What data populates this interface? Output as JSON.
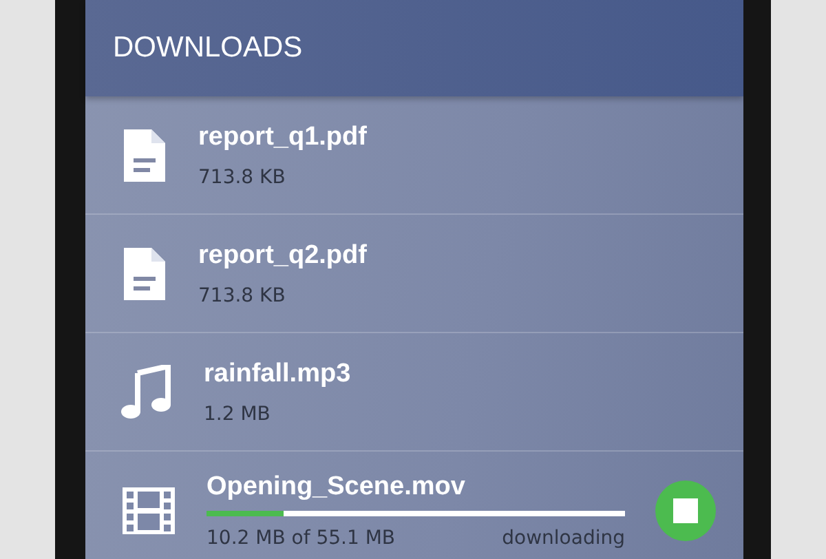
{
  "header": {
    "title": "DOWNLOADS"
  },
  "downloads": [
    {
      "kind": "document",
      "name": "report_q1.pdf",
      "size": "713.8 KB"
    },
    {
      "kind": "document",
      "name": "report_q2.pdf",
      "size": "713.8 KB"
    },
    {
      "kind": "audio",
      "name": "rainfall.mp3",
      "size": "1.2 MB"
    },
    {
      "kind": "video",
      "name": "Opening_Scene.mov",
      "size": "10.2 MB of 55.1 MB",
      "status": "downloading",
      "level": 0.185
    }
  ]
}
